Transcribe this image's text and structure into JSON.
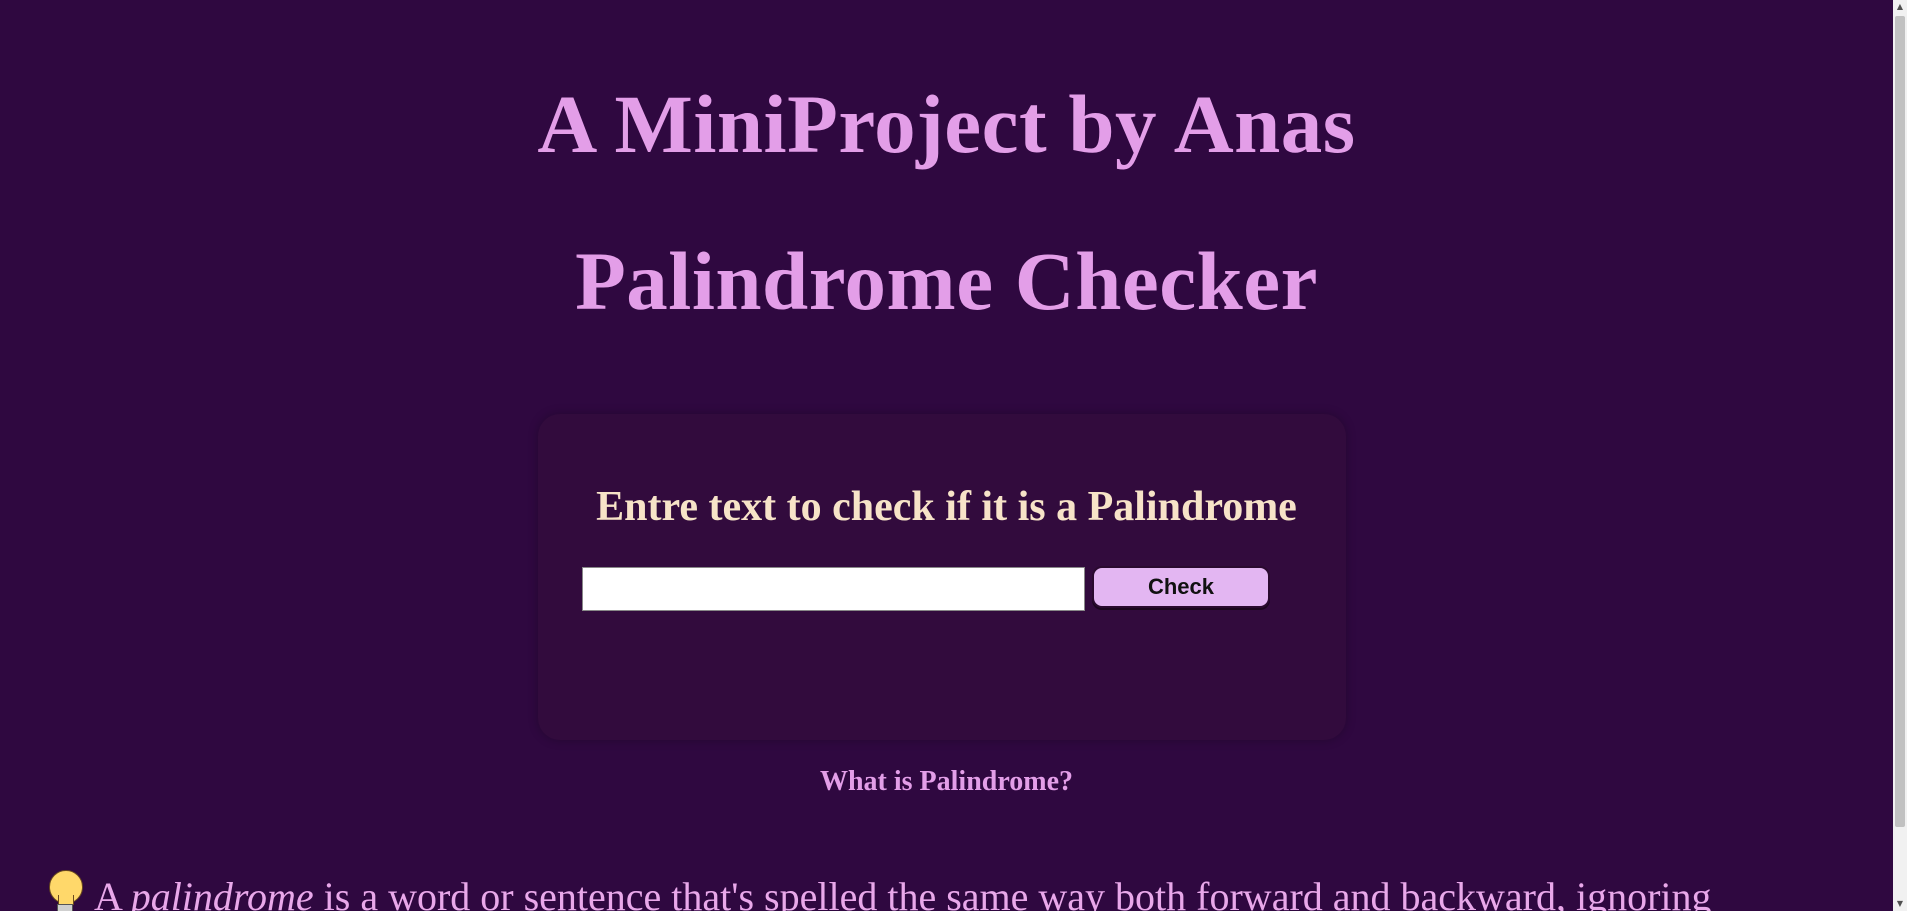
{
  "header": {
    "title_line1": "A MiniProject by Anas",
    "title_line2": "Palindrome Checker"
  },
  "checker": {
    "prompt": "Entre text to check if it is a Palindrome",
    "input_value": "",
    "button_label": "Check"
  },
  "info": {
    "link_text": "What is Palindrome?",
    "definition_prefix": "A ",
    "definition_term": "palindrome",
    "definition_rest": " is a word or sentence that's spelled the same way both forward and backward, ignoring"
  },
  "icons": {
    "bulb": "light-bulb-icon"
  },
  "colors": {
    "background": "#2f0840",
    "title": "#e39ee8",
    "card": "#320b3d",
    "prompt": "#f7e3c8",
    "button": "#e3b6f2"
  },
  "scrollbar": {
    "up": "▲",
    "down": "▼"
  }
}
